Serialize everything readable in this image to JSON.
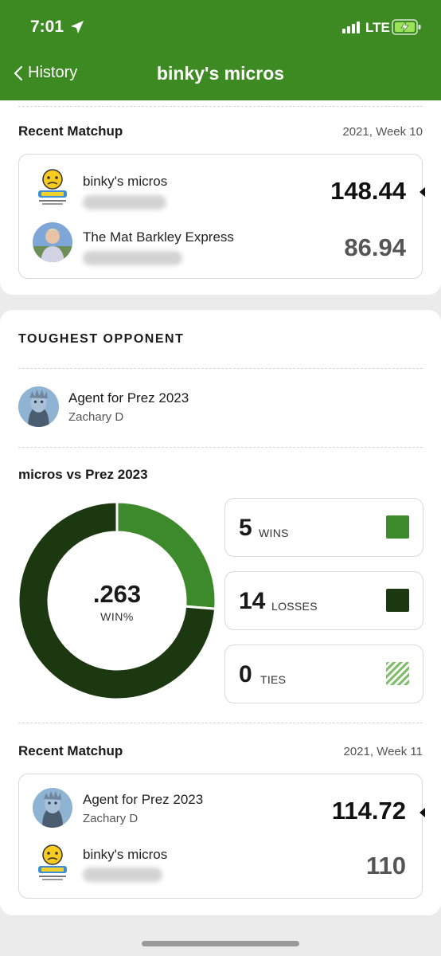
{
  "status_bar": {
    "time": "7:01",
    "network": "LTE"
  },
  "nav": {
    "back_label": "History",
    "title": "binky's micros"
  },
  "recent_matchup_1": {
    "title": "Recent Matchup",
    "week": "2021, Week 10",
    "team_a": {
      "name": "binky's micros",
      "score": "148.44"
    },
    "team_b": {
      "name": "The Mat Barkley Express",
      "score": "86.94"
    }
  },
  "toughest": {
    "title": "TOUGHEST OPPONENT",
    "opponent_name": "Agent for Prez 2023",
    "opponent_owner": "Zachary D",
    "vs_title": "micros vs Prez 2023",
    "win_pct": ".263",
    "win_pct_label": "WIN%",
    "stats": {
      "wins": {
        "value": "5",
        "label": "WINS"
      },
      "losses": {
        "value": "14",
        "label": "LOSSES"
      },
      "ties": {
        "value": "0",
        "label": "TIES"
      }
    },
    "colors": {
      "wins": "#3d8a2c",
      "losses": "#1b3810",
      "ties": "#7fbf6a"
    }
  },
  "recent_matchup_2": {
    "title": "Recent Matchup",
    "week": "2021, Week 11",
    "team_a": {
      "name": "Agent for Prez 2023",
      "owner": "Zachary D",
      "score": "114.72"
    },
    "team_b": {
      "name": "binky's micros",
      "score": "110"
    }
  }
}
